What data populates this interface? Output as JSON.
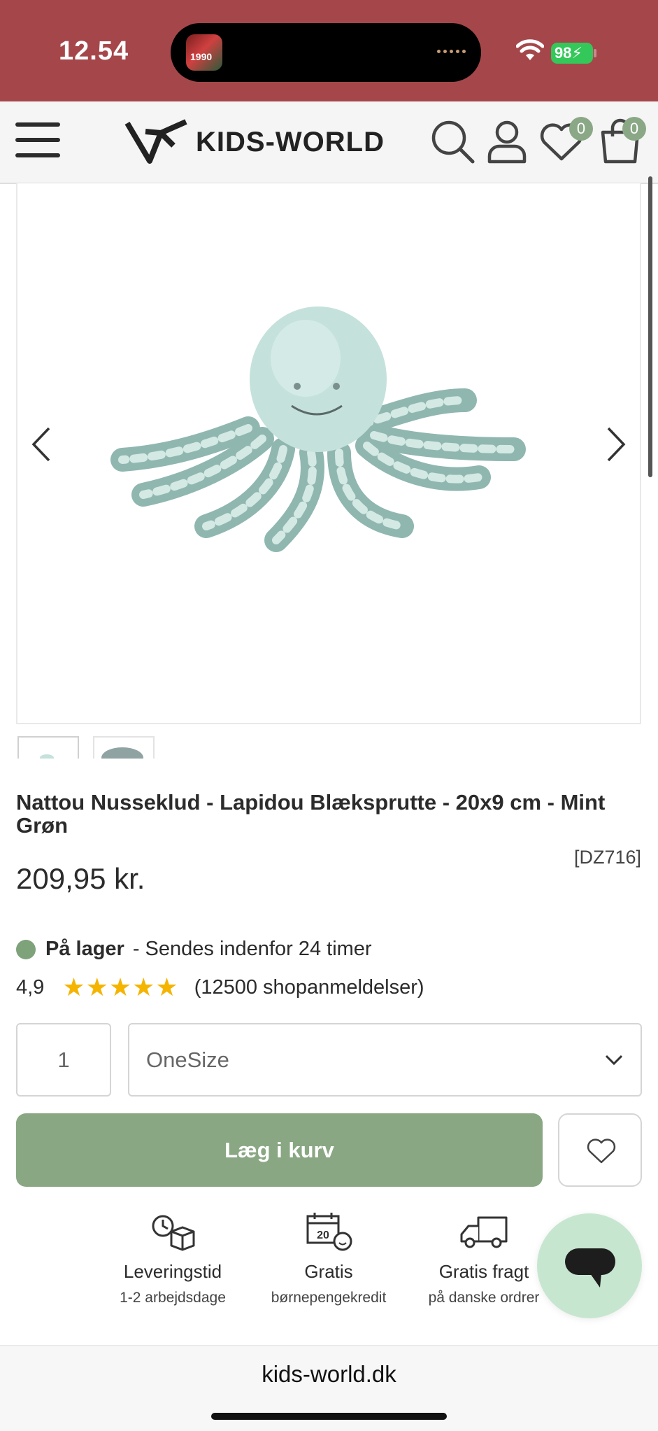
{
  "status_bar": {
    "time": "12.54",
    "battery": "98",
    "island_thumb_text": "1990"
  },
  "header": {
    "brand": "KIDS-WORLD",
    "wishlist_count": "0",
    "cart_count": "0"
  },
  "product": {
    "title": "Nattou Nusseklud - Lapidou Blæksprutte - 20x9 cm - Mint Grøn",
    "sku": "[DZ716]",
    "price": "209,95 kr.",
    "stock_label": "På lager",
    "stock_detail": "- Sendes indenfor 24 timer",
    "rating_score": "4,9",
    "stars": "★★★★★",
    "review_text": "(12500 shopanmeldelser)",
    "quantity": "1",
    "size": "OneSize",
    "add_to_cart": "Læg i kurv"
  },
  "usps": [
    {
      "title": "Leveringstid",
      "sub": "1-2 arbejdsdage"
    },
    {
      "title": "Gratis",
      "sub": "børnepengekredit"
    },
    {
      "title": "Gratis fragt",
      "sub": "på danske ordrer"
    }
  ],
  "url_bar": {
    "url": "kids-world.dk"
  },
  "colors": {
    "status_bar": "#a5474a",
    "accent_green": "#89a783",
    "star": "#f4b400",
    "chat_bubble": "#c7e6cf"
  }
}
